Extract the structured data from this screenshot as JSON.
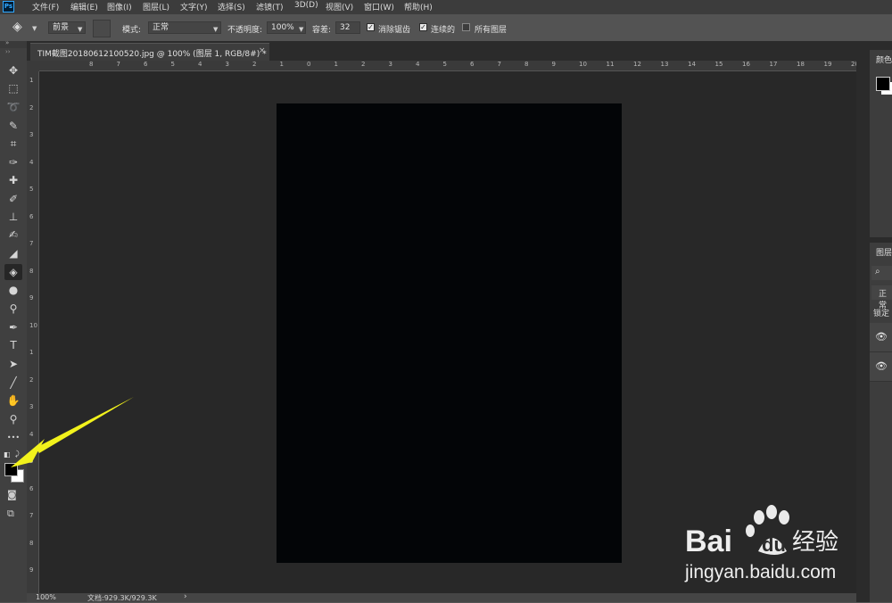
{
  "app": {
    "logo_text": "Ps"
  },
  "menubar": {
    "items": [
      "文件(F)",
      "编辑(E)",
      "图像(I)",
      "图层(L)",
      "文字(Y)",
      "选择(S)",
      "滤镜(T)",
      "3D(D)",
      "视图(V)",
      "窗口(W)",
      "帮助(H)"
    ]
  },
  "options": {
    "fill_source": "前景",
    "mode_label": "模式:",
    "mode_value": "正常",
    "opacity_label": "不透明度:",
    "opacity_value": "100%",
    "tolerance_label": "容差:",
    "tolerance_value": "32",
    "antialias_label": "消除锯齿",
    "antialias_checked": true,
    "contiguous_label": "连续的",
    "contiguous_checked": true,
    "all_layers_label": "所有图层",
    "all_layers_checked": false
  },
  "document": {
    "tab_title": "TIM截图20180612100520.jpg @ 100% (图层 1, RGB/8#) *",
    "close_glyph": "×",
    "fill_color": "#030507"
  },
  "rulers": {
    "top_labels": [
      "8",
      "7",
      "6",
      "5",
      "4",
      "3",
      "2",
      "1",
      "0",
      "1",
      "2",
      "3",
      "4",
      "5",
      "6",
      "7",
      "8",
      "9",
      "10",
      "11",
      "12",
      "13",
      "14",
      "15",
      "16",
      "17",
      "18",
      "19",
      "20",
      "21"
    ],
    "left_labels": [
      "1",
      "2",
      "3",
      "4",
      "5",
      "6",
      "7",
      "8",
      "9",
      "10",
      "1",
      "2",
      "3",
      "4",
      "5",
      "6",
      "7",
      "8",
      "9",
      "1"
    ]
  },
  "status": {
    "zoom": "100%",
    "doc_size": "文档:929.3K/929.3K",
    "arrow": "›"
  },
  "panels": {
    "color_title": "颜色",
    "layers_title": "图层",
    "layers_search_icon": "⌕",
    "layers_blend": "正常",
    "layers_lock": "锁定"
  },
  "toolbar": {
    "tools": [
      {
        "name": "move-tool-icon",
        "glyph": "✥"
      },
      {
        "name": "marquee-tool-icon",
        "glyph": "⬚"
      },
      {
        "name": "lasso-tool-icon",
        "glyph": "➰"
      },
      {
        "name": "quick-select-tool-icon",
        "glyph": "✎"
      },
      {
        "name": "crop-tool-icon",
        "glyph": "⌗"
      },
      {
        "name": "eyedropper-tool-icon",
        "glyph": "✑"
      },
      {
        "name": "healing-tool-icon",
        "glyph": "✚"
      },
      {
        "name": "brush-tool-icon",
        "glyph": "✐"
      },
      {
        "name": "stamp-tool-icon",
        "glyph": "⊥"
      },
      {
        "name": "history-brush-tool-icon",
        "glyph": "✍"
      },
      {
        "name": "eraser-tool-icon",
        "glyph": "◢"
      },
      {
        "name": "paint-bucket-tool-icon",
        "glyph": "◈"
      },
      {
        "name": "blur-tool-icon",
        "glyph": "●"
      },
      {
        "name": "dodge-tool-icon",
        "glyph": "⚲"
      },
      {
        "name": "pen-tool-icon",
        "glyph": "✒"
      },
      {
        "name": "type-tool-icon",
        "glyph": "T"
      },
      {
        "name": "path-select-tool-icon",
        "glyph": "➤"
      },
      {
        "name": "line-tool-icon",
        "glyph": "╱"
      },
      {
        "name": "hand-tool-icon",
        "glyph": "✋"
      },
      {
        "name": "zoom-tool-icon",
        "glyph": "⚲"
      },
      {
        "name": "more-tools-icon",
        "glyph": "•••"
      }
    ],
    "selected_index": 11,
    "foreground_color": "#000000",
    "background_color": "#ffffff"
  },
  "watermark": {
    "brand": "Bai",
    "brand_suffix": "du",
    "product": "经验",
    "url": "jingyan.baidu.com"
  },
  "colors": {
    "accent_annotation": "#f2f21c",
    "canvas_bg": "#282828"
  }
}
